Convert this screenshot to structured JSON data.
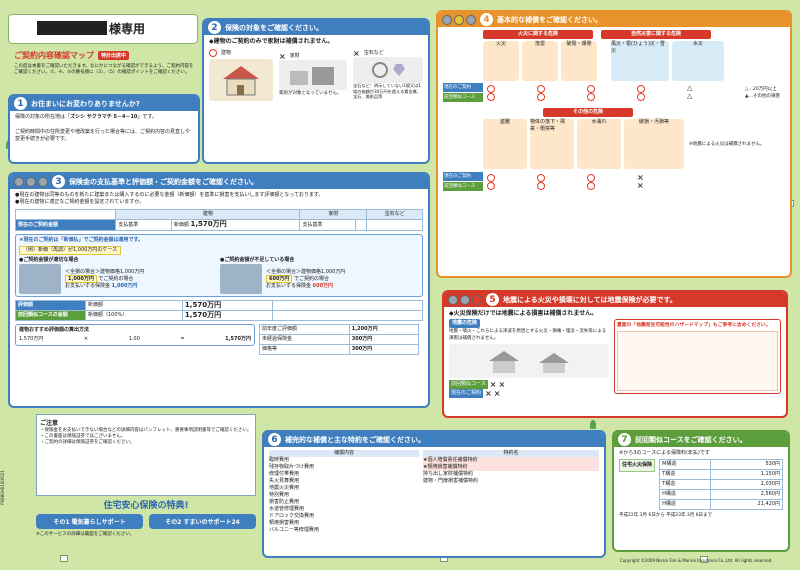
{
  "colors": {
    "bg": "#cfe6a6",
    "blue": "#3f7fc0",
    "orange": "#e8922c",
    "red": "#d6382a",
    "green": "#5c9e3c"
  },
  "header": {
    "title": "様専用",
    "map_title": "ご契約内容確認マップ",
    "map_badge": "特計出席中",
    "intro": "この度は本書をご確認いただきます。なにかにつながる確認ができるよう、ご契約内容をご確認ください。①、④、⑤の番号順に（3）、（5）の確認ポイントをご確認ください。"
  },
  "s1": {
    "num": "1",
    "title": "お住まいにお変わりありませんか?",
    "addr_label": "保険の対象の所在地は「",
    "addr": "ズシシ サクラマチ 5－4－10",
    "addr_tail": "」です。",
    "note": "ご契約時間中の住所変更や増改築を行った場合等には、ご契約内容の見直しや変更手続きが必要です。",
    "side_note": "猶木や、その他契約区間は実務所"
  },
  "s2": {
    "num": "2",
    "title": "保険の対象をご確認ください。",
    "heading": "◆建物のご契約のみで家財は補償されません。",
    "items": [
      "建物",
      "家財",
      "宝石など"
    ],
    "item_notes": [
      "",
      "家財が対象となっていません。",
      "宝石など：明示していない1個又は1組の価額が30万円を超える貴金属、宝石、美術品等"
    ]
  },
  "s3": {
    "num": "3",
    "title": "保険金の支払基準と評価額・ご契約金額をご確認ください。",
    "lines": [
      "●現在の建物は同等のものを新たに建築または購入するのに必要な金額（新価額）を基準に損害を支払いします評価額となっております。",
      "●現在の建物に適正なご契約金額を設定されていますか。"
    ],
    "headers": [
      "建物",
      "家財",
      "宝石など"
    ],
    "row_label": "現在のご契約金額",
    "pay_basis": "支払基準",
    "pay_basis_val": "新価額",
    "contract_amount": "ご契約金額",
    "amount": "1,570万円",
    "notice": "★現在のご契約は「新価払」でご契約金額は適用です。",
    "example": "（例）新価（再調）が1,000万円のケース",
    "case_ok_title": "●ご契約金額が適切な場合",
    "case_ok_line": "＜全損の場合＞建物価格1,000万円",
    "case_ok_amount": "1,000万円",
    "case_ok_pay": "でご契約の場合",
    "case_ok_result": "お支払いする保険金",
    "case_ok_result_amount": "1,000万円",
    "case_ng_title": "●ご契約金額が不足している場合",
    "case_ng_line": "＜全損の場合＞建物価格1,000万円",
    "case_ng_amount": "600万円",
    "case_ng_pay": "でご契約の場合",
    "case_ng_result": "お支払いする保険金",
    "case_ng_result_amount": "600万円",
    "rows": [
      {
        "label": "評価額",
        "basis": "新価額",
        "amount": "1,570万円"
      },
      {
        "label": "前回類似コースの金額",
        "basis": "新価額（100%）",
        "amount": "1,570万円"
      }
    ],
    "calc_title": "建物おすすめ評価額の算出方法",
    "calc_cols": [
      "延床面積",
      "係数",
      "評価額"
    ],
    "calc_vals": [
      "1,570万円",
      "1.00",
      "1,570万円"
    ],
    "side_rows": [
      {
        "k": "前年度ご評価額",
        "v": "1,200万円"
      },
      {
        "k": "未経過保険金",
        "v": "300万円"
      },
      {
        "k": "価格等",
        "v": "300万円"
      }
    ],
    "callout": "ご契約金額(同額)の範囲内で損害が生じた場合の保険金をお支払いします。"
  },
  "s4": {
    "num": "4",
    "title": "基本的な補償をご確認ください。",
    "fire_group": "火災に関する危険",
    "nature_group": "自然災害に関する危険",
    "other_group": "その他の危険",
    "fire_items": [
      "火災",
      "落雷",
      "破裂・爆発"
    ],
    "nature_items": [
      "風災・雹(ひょう)災・雪災",
      "水災"
    ],
    "other_items": [
      "盗難",
      "物体の落下・飛来・衝突等",
      "水濡れ",
      "破損・汚損等"
    ],
    "row_labels": [
      "現在のご契約",
      "前回類似コース"
    ],
    "legend": [
      "△…20万円以上",
      "△…20万円以上",
      "▲…その他の損害",
      "◎…当社負担"
    ],
    "note": "※地震による火災は補償されません。"
  },
  "s5": {
    "num": "5",
    "title": "地震による火災や損壊に対しては地震保険が必要です。",
    "heading": "◆火災保険だけでは地震による損害は補償されません。",
    "danger": "地震の危険",
    "danger_text": "地震・噴火・これらによる津波を原因とする火災・損壊・埋没・流失等による損害は補償されません。",
    "right_title": "裏面の「地震発生可能性のハザードマップ」もご参考に含めください。",
    "rows": [
      "前回類似コース",
      "現在のご契約"
    ]
  },
  "s6": {
    "num": "6",
    "title": "補完的な補償と主な特約をご確認ください。",
    "cols": [
      "補償内容",
      "特約名"
    ],
    "items": [
      "臨時費用",
      "残存物取片づけ費用",
      "修理付帯費用",
      "失火見舞費用",
      "地震火災費用",
      "特別費用",
      "損害防止費用",
      "水道管修理費用",
      "ドアロック交換費用",
      "類焼損害費用",
      "バルコニー等修理費用"
    ],
    "riders": [
      "★個人賠償責任補償特約",
      "★類焼損害補償特約",
      "持ち出し家財補償特約",
      "建物・門扉損害補償特約"
    ]
  },
  "s7": {
    "num": "7",
    "title": "前回類似コースをご確認ください。",
    "subtitle": "※から3のコースによる保険料(年払)です",
    "course": "住宅火災保険",
    "plans": [
      {
        "k": "M構造",
        "v": "530円"
      },
      {
        "k": "T構造",
        "v": "1,150円"
      },
      {
        "k": "T構造",
        "v": "2,030円"
      },
      {
        "k": "H構造",
        "v": "2,560円"
      },
      {
        "k": "H構造",
        "v": "21,420円"
      }
    ],
    "period": "平成22年 3月 6日から 平成23年 3月 6日まで",
    "copyright": "Copyright ©2009 Nissin Fire & Marine Insurance Co.,Ltd. All rights reserved."
  },
  "notes": {
    "title": "ご注意",
    "lines": [
      "・保険金をお支払いできない場合などの詳細内容はパンフレット、重要事項説明書等でご確認ください。",
      "・この書面は保険証券ではございません。",
      "・ご契約の詳細は保険証券をご確認ください。"
    ],
    "side_label": "P0880H010IX021"
  },
  "special": {
    "title": "住宅安心保険の特典!",
    "btn1": "その1 電気暮らしサポート",
    "btn2": "その2 すまいのサポート24",
    "footnote": "※このサービスの詳細は裏面をご確認ください。"
  }
}
